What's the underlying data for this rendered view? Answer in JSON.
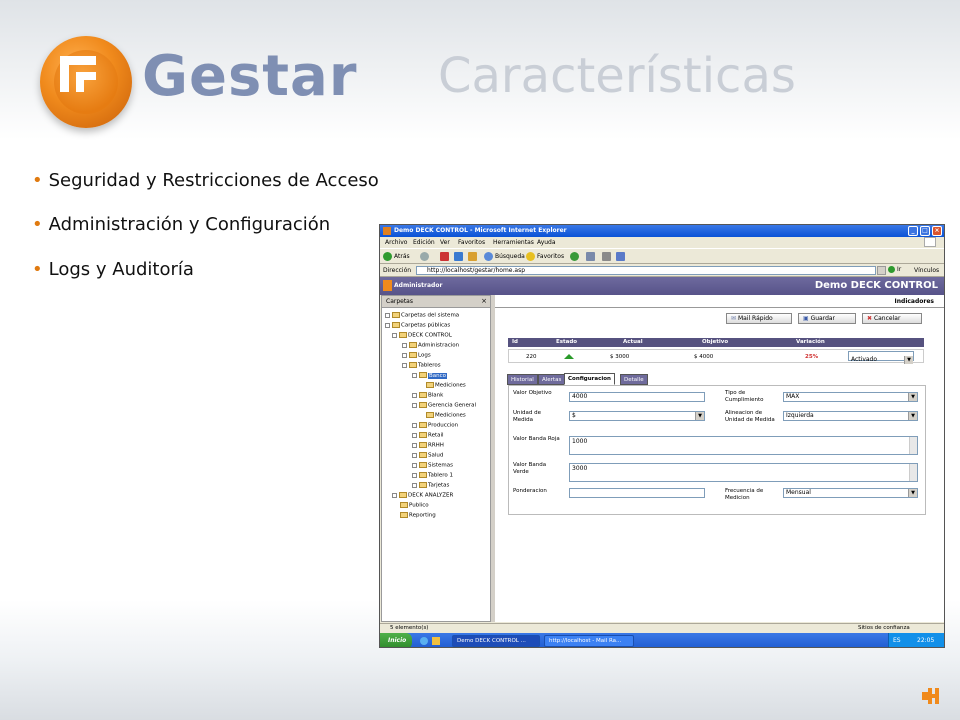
{
  "slide": {
    "brand": "Gestar",
    "title": "Características",
    "bullets": [
      "Seguridad y Restricciones de Acceso",
      "Administración y Configuración",
      "Logs y Auditoría"
    ],
    "accent": "#f08a1c"
  },
  "browser": {
    "window_title": "Demo DECK CONTROL - Microsoft Internet Explorer",
    "menu": [
      "Archivo",
      "Edición",
      "Ver",
      "Favoritos",
      "Herramientas",
      "Ayuda"
    ],
    "toolbar": {
      "back": "Atrás",
      "search": "Búsqueda",
      "favorites": "Favoritos"
    },
    "address_label": "Dirección",
    "address": "http://localhost/gestar/home.asp",
    "go": "Ir",
    "links": "Vínculos"
  },
  "app": {
    "user": "Administrador",
    "name": "Demo DECK CONTROL",
    "sidebar_title": "Carpetas",
    "sidebar_close": "×",
    "tree": [
      {
        "label": "Carpetas del sistema"
      },
      {
        "label": "Carpetas públicas"
      },
      {
        "label": "DECK CONTROL"
      },
      {
        "label": "Administracion"
      },
      {
        "label": "Logs"
      },
      {
        "label": "Tableros"
      },
      {
        "label": "Banco"
      },
      {
        "label": "Mediciones"
      },
      {
        "label": "Blank"
      },
      {
        "label": "Gerencia General"
      },
      {
        "label": "Mediciones"
      },
      {
        "label": "Produccion"
      },
      {
        "label": "Retail"
      },
      {
        "label": "RRHH"
      },
      {
        "label": "Salud"
      },
      {
        "label": "Sistemas"
      },
      {
        "label": "Tablero 1"
      },
      {
        "label": "Tarjetas"
      },
      {
        "label": "DECK ANALYZER"
      },
      {
        "label": "Publico"
      },
      {
        "label": "Reporting"
      }
    ],
    "section_title": "Indicadores",
    "actions": {
      "mail": "Mail Rápido",
      "save": "Guardar",
      "cancel": "Cancelar"
    },
    "grid": {
      "headers": [
        "Id",
        "Estado",
        "Actual",
        "Objetivo",
        "Variación"
      ],
      "row": {
        "id": "220",
        "actual": "$ 3000",
        "objetivo": "$ 4000",
        "variacion": "25%",
        "status": "Activado"
      }
    },
    "tabs": [
      "Historial",
      "Alertas",
      "Configuracion",
      "Detalle"
    ],
    "form": {
      "valor_objetivo_label": "Valor Objetivo",
      "valor_objetivo": "4000",
      "tipo_cumplimiento_label": "Tipo de Cumplimiento",
      "tipo_cumplimiento": "MAX",
      "unidad_medida_label": "Unidad de Medida",
      "unidad_medida": "$",
      "alineacion_label": "Alineacion de Unidad de Medida",
      "alineacion": "Izquierda",
      "banda_roja_label": "Valor Banda Roja",
      "banda_roja": "1000",
      "banda_verde_label": "Valor Banda Verde",
      "banda_verde": "3000",
      "ponderacion_label": "Ponderacion",
      "ponderacion": "",
      "frecuencia_label": "Frecuencia de Medicion",
      "frecuencia": "Mensual"
    }
  },
  "status": {
    "items": "5 elemento(s)",
    "zone": "Sitios de confianza"
  },
  "taskbar": {
    "start": "Inicio",
    "tasks": [
      "Demo DECK CONTROL ...",
      "http://localhost - Mail Ra..."
    ],
    "lang": "ES",
    "clock": "22:05"
  }
}
